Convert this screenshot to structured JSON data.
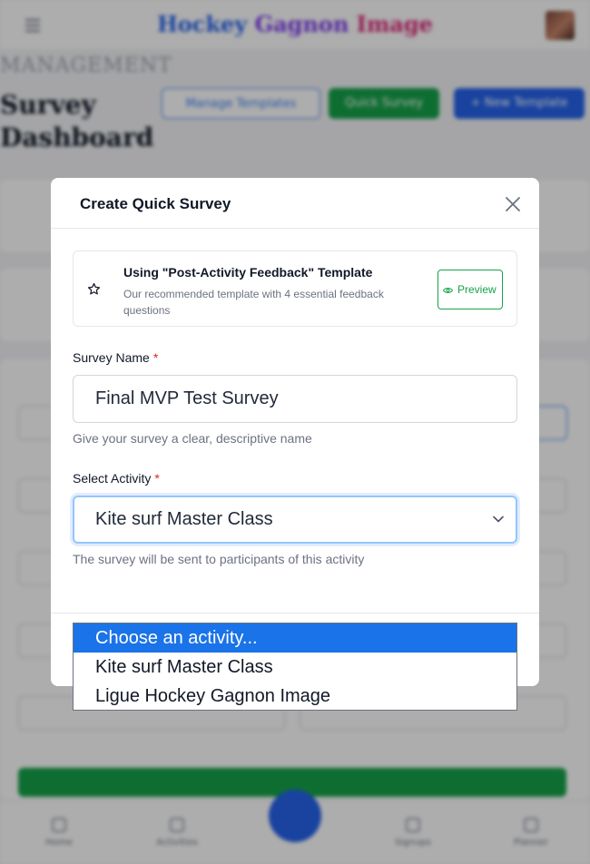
{
  "app": {
    "brand": {
      "part1": "Hockey",
      "part2": "Gagnon",
      "part3": "Image"
    },
    "eyebrow": "MANAGEMENT",
    "page_title": "Survey Dashboard",
    "header_buttons": {
      "manage_templates": "Manage Templates",
      "quick_survey": "Quick Survey",
      "new_template": "+ New Template"
    },
    "bottom_nav": [
      "Home",
      "Activities",
      "",
      "Signups",
      "Planner"
    ]
  },
  "modal": {
    "title": "Create Quick Survey",
    "template": {
      "title": "Using \"Post-Activity Feedback\" Template",
      "description": "Our recommended template with 4 essential feedback questions",
      "preview_label": "Preview"
    },
    "survey_name": {
      "label": "Survey Name",
      "required_mark": "*",
      "value": "Final MVP Test Survey",
      "help": "Give your survey a clear, descriptive name"
    },
    "activity": {
      "label": "Select Activity",
      "required_mark": "*",
      "selected": "Kite surf Master Class",
      "help": "The survey will be sent to participants of this activity",
      "options": [
        "Choose an activity...",
        "Kite surf Master Class",
        "Ligue Hockey Gagnon Image"
      ],
      "highlighted_index": 0
    }
  },
  "colors": {
    "primary": "#2563eb",
    "success": "#16a34a",
    "required": "#dc2626",
    "dropdown_highlight": "#1a73e8"
  },
  "icons": {
    "close": "close-icon",
    "star": "star-icon",
    "preview": "eye-icon",
    "select": "chevron-down-icon"
  }
}
